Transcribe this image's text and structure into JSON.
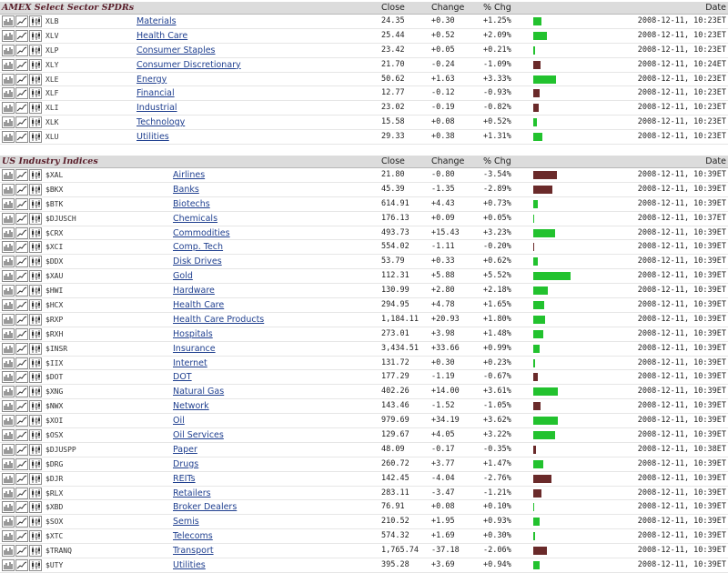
{
  "colors": {
    "up": "#22c22e",
    "down": "#6a2a2a",
    "header_title": "#5a1f2b",
    "link": "#1f3f8f"
  },
  "icons": [
    "bar-chart-icon",
    "line-chart-icon",
    "candlestick-chart-icon"
  ],
  "amex": {
    "title": "AMEX Select Sector SPDRs",
    "col_close": "Close",
    "col_change": "Change",
    "col_pct": "% Chg",
    "col_date": "Date",
    "rows": [
      {
        "symbol": "XLB",
        "name": "Materials",
        "close": "24.35",
        "change": "+0.30",
        "pct": "+1.25%",
        "pct_value": 1.25,
        "date": "2008-12-11, 10:23ET"
      },
      {
        "symbol": "XLV",
        "name": "Health Care",
        "close": "25.44",
        "change": "+0.52",
        "pct": "+2.09%",
        "pct_value": 2.09,
        "date": "2008-12-11, 10:23ET"
      },
      {
        "symbol": "XLP",
        "name": "Consumer Staples",
        "close": "23.42",
        "change": "+0.05",
        "pct": "+0.21%",
        "pct_value": 0.21,
        "date": "2008-12-11, 10:23ET"
      },
      {
        "symbol": "XLY",
        "name": "Consumer Discretionary",
        "close": "21.70",
        "change": "-0.24",
        "pct": "-1.09%",
        "pct_value": -1.09,
        "date": "2008-12-11, 10:24ET"
      },
      {
        "symbol": "XLE",
        "name": "Energy",
        "close": "50.62",
        "change": "+1.63",
        "pct": "+3.33%",
        "pct_value": 3.33,
        "date": "2008-12-11, 10:23ET"
      },
      {
        "symbol": "XLF",
        "name": "Financial",
        "close": "12.77",
        "change": "-0.12",
        "pct": "-0.93%",
        "pct_value": -0.93,
        "date": "2008-12-11, 10:23ET"
      },
      {
        "symbol": "XLI",
        "name": "Industrial",
        "close": "23.02",
        "change": "-0.19",
        "pct": "-0.82%",
        "pct_value": -0.82,
        "date": "2008-12-11, 10:23ET"
      },
      {
        "symbol": "XLK",
        "name": "Technology",
        "close": "15.58",
        "change": "+0.08",
        "pct": "+0.52%",
        "pct_value": 0.52,
        "date": "2008-12-11, 10:23ET"
      },
      {
        "symbol": "XLU",
        "name": "Utilities",
        "close": "29.33",
        "change": "+0.38",
        "pct": "+1.31%",
        "pct_value": 1.31,
        "date": "2008-12-11, 10:23ET"
      }
    ]
  },
  "industry": {
    "title": "US Industry Indices",
    "col_close": "Close",
    "col_change": "Change",
    "col_pct": "% Chg",
    "col_date": "Date",
    "rows": [
      {
        "symbol": "$XAL",
        "name": "Airlines",
        "close": "21.80",
        "change": "-0.80",
        "pct": "-3.54%",
        "pct_value": -3.54,
        "date": "2008-12-11, 10:39ET"
      },
      {
        "symbol": "$BKX",
        "name": "Banks",
        "close": "45.39",
        "change": "-1.35",
        "pct": "-2.89%",
        "pct_value": -2.89,
        "date": "2008-12-11, 10:39ET"
      },
      {
        "symbol": "$BTK",
        "name": "Biotechs",
        "close": "614.91",
        "change": "+4.43",
        "pct": "+0.73%",
        "pct_value": 0.73,
        "date": "2008-12-11, 10:39ET"
      },
      {
        "symbol": "$DJUSCH",
        "name": "Chemicals",
        "close": "176.13",
        "change": "+0.09",
        "pct": "+0.05%",
        "pct_value": 0.05,
        "date": "2008-12-11, 10:37ET"
      },
      {
        "symbol": "$CRX",
        "name": "Commodities",
        "close": "493.73",
        "change": "+15.43",
        "pct": "+3.23%",
        "pct_value": 3.23,
        "date": "2008-12-11, 10:39ET"
      },
      {
        "symbol": "$XCI",
        "name": "Comp. Tech",
        "close": "554.02",
        "change": "-1.11",
        "pct": "-0.20%",
        "pct_value": -0.2,
        "date": "2008-12-11, 10:39ET"
      },
      {
        "symbol": "$DDX",
        "name": "Disk Drives",
        "close": "53.79",
        "change": "+0.33",
        "pct": "+0.62%",
        "pct_value": 0.62,
        "date": "2008-12-11, 10:39ET"
      },
      {
        "symbol": "$XAU",
        "name": "Gold",
        "close": "112.31",
        "change": "+5.88",
        "pct": "+5.52%",
        "pct_value": 5.52,
        "date": "2008-12-11, 10:39ET"
      },
      {
        "symbol": "$HWI",
        "name": "Hardware",
        "close": "130.99",
        "change": "+2.80",
        "pct": "+2.18%",
        "pct_value": 2.18,
        "date": "2008-12-11, 10:39ET"
      },
      {
        "symbol": "$HCX",
        "name": "Health Care",
        "close": "294.95",
        "change": "+4.78",
        "pct": "+1.65%",
        "pct_value": 1.65,
        "date": "2008-12-11, 10:39ET"
      },
      {
        "symbol": "$RXP",
        "name": "Health Care Products",
        "close": "1,184.11",
        "change": "+20.93",
        "pct": "+1.80%",
        "pct_value": 1.8,
        "date": "2008-12-11, 10:39ET"
      },
      {
        "symbol": "$RXH",
        "name": "Hospitals",
        "close": "273.01",
        "change": "+3.98",
        "pct": "+1.48%",
        "pct_value": 1.48,
        "date": "2008-12-11, 10:39ET"
      },
      {
        "symbol": "$INSR",
        "name": "Insurance",
        "close": "3,434.51",
        "change": "+33.66",
        "pct": "+0.99%",
        "pct_value": 0.99,
        "date": "2008-12-11, 10:39ET"
      },
      {
        "symbol": "$IIX",
        "name": "Internet",
        "close": "131.72",
        "change": "+0.30",
        "pct": "+0.23%",
        "pct_value": 0.23,
        "date": "2008-12-11, 10:39ET"
      },
      {
        "symbol": "$DOT",
        "name": "DOT",
        "close": "177.29",
        "change": "-1.19",
        "pct": "-0.67%",
        "pct_value": -0.67,
        "date": "2008-12-11, 10:39ET"
      },
      {
        "symbol": "$XNG",
        "name": "Natural Gas",
        "close": "402.26",
        "change": "+14.00",
        "pct": "+3.61%",
        "pct_value": 3.61,
        "date": "2008-12-11, 10:39ET"
      },
      {
        "symbol": "$NWX",
        "name": "Network",
        "close": "143.46",
        "change": "-1.52",
        "pct": "-1.05%",
        "pct_value": -1.05,
        "date": "2008-12-11, 10:39ET"
      },
      {
        "symbol": "$XOI",
        "name": "Oil",
        "close": "979.69",
        "change": "+34.19",
        "pct": "+3.62%",
        "pct_value": 3.62,
        "date": "2008-12-11, 10:39ET"
      },
      {
        "symbol": "$OSX",
        "name": "Oil Services",
        "close": "129.67",
        "change": "+4.05",
        "pct": "+3.22%",
        "pct_value": 3.22,
        "date": "2008-12-11, 10:39ET"
      },
      {
        "symbol": "$DJUSPP",
        "name": "Paper",
        "close": "48.09",
        "change": "-0.17",
        "pct": "-0.35%",
        "pct_value": -0.35,
        "date": "2008-12-11, 10:38ET"
      },
      {
        "symbol": "$DRG",
        "name": "Drugs",
        "close": "260.72",
        "change": "+3.77",
        "pct": "+1.47%",
        "pct_value": 1.47,
        "date": "2008-12-11, 10:39ET"
      },
      {
        "symbol": "$DJR",
        "name": "REITs",
        "close": "142.45",
        "change": "-4.04",
        "pct": "-2.76%",
        "pct_value": -2.76,
        "date": "2008-12-11, 10:39ET"
      },
      {
        "symbol": "$RLX",
        "name": "Retailers",
        "close": "283.11",
        "change": "-3.47",
        "pct": "-1.21%",
        "pct_value": -1.21,
        "date": "2008-12-11, 10:39ET"
      },
      {
        "symbol": "$XBD",
        "name": "Broker Dealers",
        "close": "76.91",
        "change": "+0.08",
        "pct": "+0.10%",
        "pct_value": 0.1,
        "date": "2008-12-11, 10:39ET"
      },
      {
        "symbol": "$SOX",
        "name": "Semis",
        "close": "210.52",
        "change": "+1.95",
        "pct": "+0.93%",
        "pct_value": 0.93,
        "date": "2008-12-11, 10:39ET"
      },
      {
        "symbol": "$XTC",
        "name": "Telecoms",
        "close": "574.32",
        "change": "+1.69",
        "pct": "+0.30%",
        "pct_value": 0.3,
        "date": "2008-12-11, 10:39ET"
      },
      {
        "symbol": "$TRANQ",
        "name": "Transport",
        "close": "1,765.74",
        "change": "-37.18",
        "pct": "-2.06%",
        "pct_value": -2.06,
        "date": "2008-12-11, 10:39ET"
      },
      {
        "symbol": "$UTY",
        "name": "Utilities",
        "close": "395.28",
        "change": "+3.69",
        "pct": "+0.94%",
        "pct_value": 0.94,
        "date": "2008-12-11, 10:39ET"
      }
    ]
  }
}
